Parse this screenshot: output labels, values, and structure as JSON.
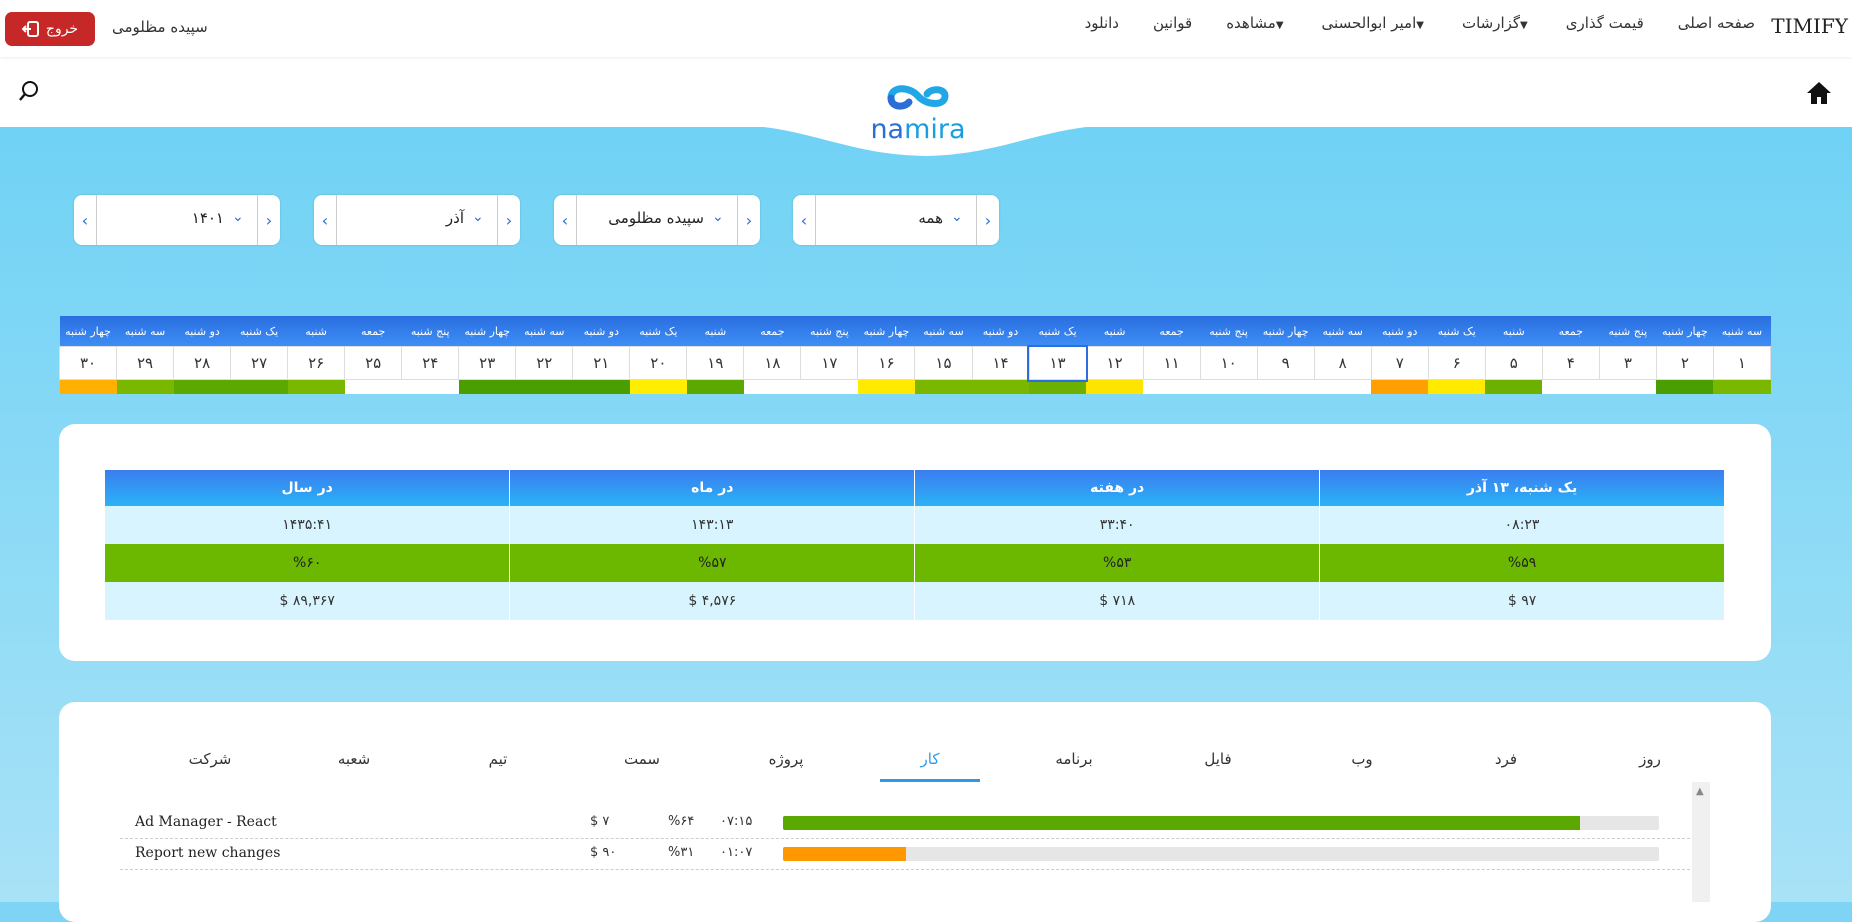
{
  "brand": "TIMIFY",
  "nav": [
    {
      "label": "صفحه اصلی",
      "caret": false
    },
    {
      "label": "قیمت گذاری",
      "caret": false
    },
    {
      "label": "گزارشات",
      "caret": true
    },
    {
      "label": "امیر ابوالحسنی",
      "caret": true
    },
    {
      "label": "مشاهده",
      "caret": true
    },
    {
      "label": "قوانین",
      "caret": false
    },
    {
      "label": "دانلود",
      "caret": false
    }
  ],
  "user": {
    "name": "سپیده مظلومی",
    "logout_label": "خروج"
  },
  "logo": {
    "word_a": "na",
    "word_b": "mira"
  },
  "filters": {
    "type": "همه",
    "person": "سپیده مظلومی",
    "month": "آذر",
    "year": "۱۴۰۱"
  },
  "calendar": {
    "selected_index": 12,
    "days": [
      {
        "name": "سه شنبه",
        "num": "۱",
        "color": "#7ab800"
      },
      {
        "name": "چهار شنبه",
        "num": "۲",
        "color": "#4a9e00"
      },
      {
        "name": "پنج شنبه",
        "num": "۳",
        "color": ""
      },
      {
        "name": "جمعه",
        "num": "۴",
        "color": ""
      },
      {
        "name": "شنبه",
        "num": "۵",
        "color": "#6cb000"
      },
      {
        "name": "یک شنبه",
        "num": "۶",
        "color": "#ffea00"
      },
      {
        "name": "دو شنبه",
        "num": "۷",
        "color": "#ffa000"
      },
      {
        "name": "سه شنبه",
        "num": "۸",
        "color": ""
      },
      {
        "name": "چهار شنبه",
        "num": "۹",
        "color": ""
      },
      {
        "name": "پنج شنبه",
        "num": "۱۰",
        "color": ""
      },
      {
        "name": "جمعه",
        "num": "۱۱",
        "color": ""
      },
      {
        "name": "شنبه",
        "num": "۱۲",
        "color": "#ffe400"
      },
      {
        "name": "یک شنبه",
        "num": "۱۳",
        "color": "#6cb000"
      },
      {
        "name": "دو شنبه",
        "num": "۱۴",
        "color": "#7ab800"
      },
      {
        "name": "سه شنبه",
        "num": "۱۵",
        "color": "#7ab800"
      },
      {
        "name": "چهار شنبه",
        "num": "۱۶",
        "color": "#ffea00"
      },
      {
        "name": "پنج شنبه",
        "num": "۱۷",
        "color": ""
      },
      {
        "name": "جمعه",
        "num": "۱۸",
        "color": ""
      },
      {
        "name": "شنبه",
        "num": "۱۹",
        "color": "#5aa800"
      },
      {
        "name": "یک شنبه",
        "num": "۲۰",
        "color": "#ffee00"
      },
      {
        "name": "دو شنبه",
        "num": "۲۱",
        "color": "#4a9e00"
      },
      {
        "name": "سه شنبه",
        "num": "۲۲",
        "color": "#4a9e00"
      },
      {
        "name": "چهار شنبه",
        "num": "۲۳",
        "color": "#4a9e00"
      },
      {
        "name": "پنج شنبه",
        "num": "۲۴",
        "color": ""
      },
      {
        "name": "جمعه",
        "num": "۲۵",
        "color": ""
      },
      {
        "name": "شنبه",
        "num": "۲۶",
        "color": "#7ab800"
      },
      {
        "name": "یک شنبه",
        "num": "۲۷",
        "color": "#5aa800"
      },
      {
        "name": "دو شنبه",
        "num": "۲۸",
        "color": "#5aa800"
      },
      {
        "name": "سه شنبه",
        "num": "۲۹",
        "color": "#7ab800"
      },
      {
        "name": "چهار شنبه",
        "num": "۳۰",
        "color": "#ffb000"
      }
    ]
  },
  "summary": {
    "headers": [
      "یک شنبه، ۱۳ آذر",
      "در هفته",
      "در ماه",
      "در سال"
    ],
    "rows": [
      [
        "۰۸:۲۳",
        "۳۳:۴۰",
        "۱۴۳:۱۳",
        "۱۴۳۵:۴۱"
      ],
      [
        "%۵۹",
        "%۵۳",
        "%۵۷",
        "%۶۰"
      ],
      [
        "$ ۹۷",
        "$ ۷۱۸",
        "$ ۴,۵۷۶",
        "$ ۸۹,۳۶۷"
      ]
    ]
  },
  "tabs": [
    {
      "label": "روز",
      "active": false
    },
    {
      "label": "فرد",
      "active": false
    },
    {
      "label": "وب",
      "active": false
    },
    {
      "label": "فایل",
      "active": false
    },
    {
      "label": "برنامه",
      "active": false
    },
    {
      "label": "کار",
      "active": true
    },
    {
      "label": "پروژه",
      "active": false
    },
    {
      "label": "سمت",
      "active": false
    },
    {
      "label": "تیم",
      "active": false
    },
    {
      "label": "شعبه",
      "active": false
    },
    {
      "label": "شرکت",
      "active": false
    }
  ],
  "tasks": [
    {
      "name": "Ad Manager - React",
      "cost": "$ ۷",
      "pct": "%۶۴",
      "time": "۰۷:۱۵",
      "progress": 0.91,
      "color": "#5aa800"
    },
    {
      "name": "Report new changes",
      "cost": "$ ۹۰",
      "pct": "%۳۱",
      "time": "۰۱:۰۷",
      "progress": 0.14,
      "color": "#ff9800"
    }
  ],
  "colors": {
    "accent": "#2c9be6",
    "logout": "#c62828",
    "header_blue": "#2a6ee0",
    "sky": "#7fd3f4"
  }
}
